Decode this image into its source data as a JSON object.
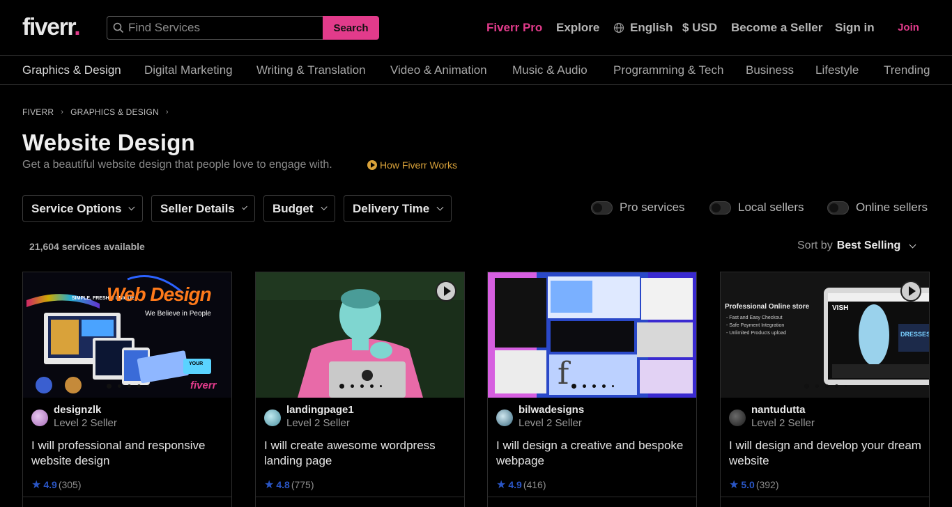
{
  "header": {
    "logo_text": "fiverr",
    "logo_dot": ".",
    "search_placeholder": "Find Services",
    "search_button": "Search",
    "nav": {
      "pro": "Fiverr Pro",
      "explore": "Explore",
      "language": "English",
      "currency": "$ USD",
      "become_seller": "Become a Seller",
      "sign_in": "Sign in",
      "join": "Join"
    }
  },
  "categories": [
    "Graphics & Design",
    "Digital Marketing",
    "Writing & Translation",
    "Video & Animation",
    "Music & Audio",
    "Programming & Tech",
    "Business",
    "Lifestyle",
    "Trending"
  ],
  "breadcrumb": [
    "FIVERR",
    "GRAPHICS & DESIGN"
  ],
  "page": {
    "title": "Website Design",
    "subtitle": "Get a beautiful website design that people love to engage with.",
    "how_link": "How Fiverr Works"
  },
  "filters": [
    "Service Options",
    "Seller Details",
    "Budget",
    "Delivery Time"
  ],
  "toggles": [
    "Pro services",
    "Local sellers",
    "Online sellers"
  ],
  "results": {
    "count": "21,604 services available",
    "sort_label": "Sort by",
    "sort_value": "Best Selling"
  },
  "gigs": [
    {
      "seller": "designzlk",
      "level": "Level 2 Seller",
      "title": "I will professional and responsive website design",
      "rating": "4.9",
      "reviews": "(305)",
      "thumb_heading": "Web Design",
      "thumb_tag": "We Believe in People",
      "thumb_kicker": "SIMPLE, FRESH & UNIQUE",
      "thumb_brand": "fiverr",
      "thumb_badge": "YOUR"
    },
    {
      "seller": "landingpage1",
      "level": "Level 2 Seller",
      "title": "I will create awesome wordpress landing page",
      "rating": "4.8",
      "reviews": "(775)"
    },
    {
      "seller": "bilwadesigns",
      "level": "Level 2 Seller",
      "title": "I will design a creative and bespoke webpage",
      "rating": "4.9",
      "reviews": "(416)"
    },
    {
      "seller": "nantudutta",
      "level": "Level 2 Seller",
      "title": "I will design and develop your dream website",
      "rating": "5.0",
      "reviews": "(392)",
      "thumb_heading": "Professional Online store",
      "thumb_points": [
        "- Fast and Easy Checkout",
        "- Safe Payment Integration",
        "- Unlimited Products upload"
      ],
      "thumb_store": "VISH",
      "thumb_promo": "DRESSES"
    }
  ],
  "colors": {
    "accent": "#e23b8b",
    "rating": "#2a56c6",
    "link": "#d9a23a"
  }
}
